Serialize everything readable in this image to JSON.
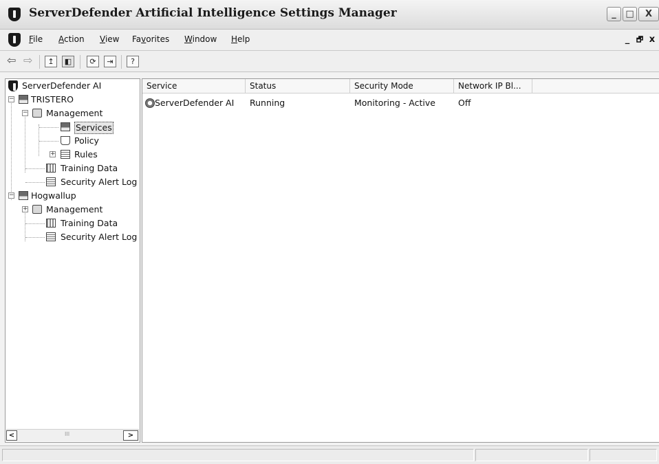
{
  "window": {
    "title": "ServerDefender Artificial Intelligence Settings Manager",
    "controls": {
      "minimize": "_",
      "maximize": "□",
      "close": "X"
    }
  },
  "menubar": {
    "items": [
      {
        "label": "File",
        "ul": "F",
        "rest": "ile"
      },
      {
        "label": "Action",
        "ul": "A",
        "rest": "ction"
      },
      {
        "label": "View",
        "ul": "V",
        "rest": "iew"
      },
      {
        "label": "Favorites",
        "pre": "Fa",
        "ul": "v",
        "rest": "orites"
      },
      {
        "label": "Window",
        "ul": "W",
        "rest": "indow"
      },
      {
        "label": "Help",
        "ul": "H",
        "rest": "elp"
      }
    ],
    "mdi_controls": {
      "minimize": "_",
      "restore": "🗗",
      "close": "x"
    }
  },
  "toolbar": {
    "back_icon": "back-arrow-icon",
    "forward_icon": "forward-arrow-icon",
    "up_icon": "up-one-level-icon",
    "tree_toggle_icon": "show-hide-tree-icon",
    "refresh_icon": "refresh-icon",
    "export_icon": "export-list-icon",
    "help_icon": "help-icon"
  },
  "tree": {
    "root": "ServerDefender AI",
    "nodes": {
      "tristero": "TRISTERO",
      "tristero_management": "Management",
      "tristero_services": "Services",
      "tristero_policy": "Policy",
      "tristero_rules": "Rules",
      "tristero_training": "Training Data",
      "tristero_alertlog": "Security Alert Log",
      "hogwallup": "Hogwallup",
      "hogwallup_management": "Management",
      "hogwallup_training": "Training Data",
      "hogwallup_alertlog": "Security Alert Log"
    },
    "selected": "Services",
    "scrollbar_grip": "III"
  },
  "list": {
    "columns": [
      "Service",
      "Status",
      "Security Mode",
      "Network IP Bl..."
    ],
    "rows": [
      {
        "service": "ServerDefender AI",
        "status": "Running",
        "mode": "Monitoring - Active",
        "network_ip": "Off"
      }
    ]
  }
}
